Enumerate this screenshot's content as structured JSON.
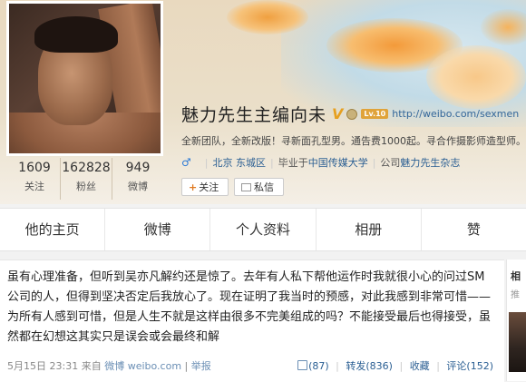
{
  "profile": {
    "name": "魅力先生主编向未",
    "verified_badge": "V",
    "level_badge": "Lv.10",
    "url": "http://weibo.com/sexmen",
    "bio": "全新团队，全新改版！寻新面孔型男。通告费1000起。寻合作摄影师造型师。",
    "location": "北京 东城区",
    "school_prefix": "毕业于",
    "school": "中国传媒大学",
    "company_prefix": "公司",
    "company": "魅力先生杂志",
    "gender_symbol": "♂"
  },
  "stats": [
    {
      "value": "1609",
      "label": "关注"
    },
    {
      "value": "162828",
      "label": "粉丝"
    },
    {
      "value": "949",
      "label": "微博"
    }
  ],
  "buttons": {
    "follow_plus": "+",
    "follow": "关注",
    "message": "私信"
  },
  "tabs": [
    {
      "label": "他的主页"
    },
    {
      "label": "微博"
    },
    {
      "label": "个人资料"
    },
    {
      "label": "相册"
    },
    {
      "label": "赞"
    }
  ],
  "post": {
    "text": "虽有心理准备，但听到吴亦凡解约还是惊了。去年有人私下帮他运作时我就很小心的问过SM公司的人，但得到坚决否定后我放心了。现在证明了我当时的预感，对此我感到非常可惜——为所有人感到可惜，但是人生不就是这样由很多不完美组成的吗？不能接受最后也得接受，虽然都在幻想这其实只是误会或会最终和解",
    "timestamp": "5月15日 23:31",
    "source_prefix": "来自",
    "source": "微博 weibo.com",
    "report": "举报",
    "likes": "(87)",
    "repost": "转发(836)",
    "favorite": "收藏",
    "comment": "评论(152)"
  },
  "side": {
    "title": "相",
    "subtitle": "推"
  }
}
